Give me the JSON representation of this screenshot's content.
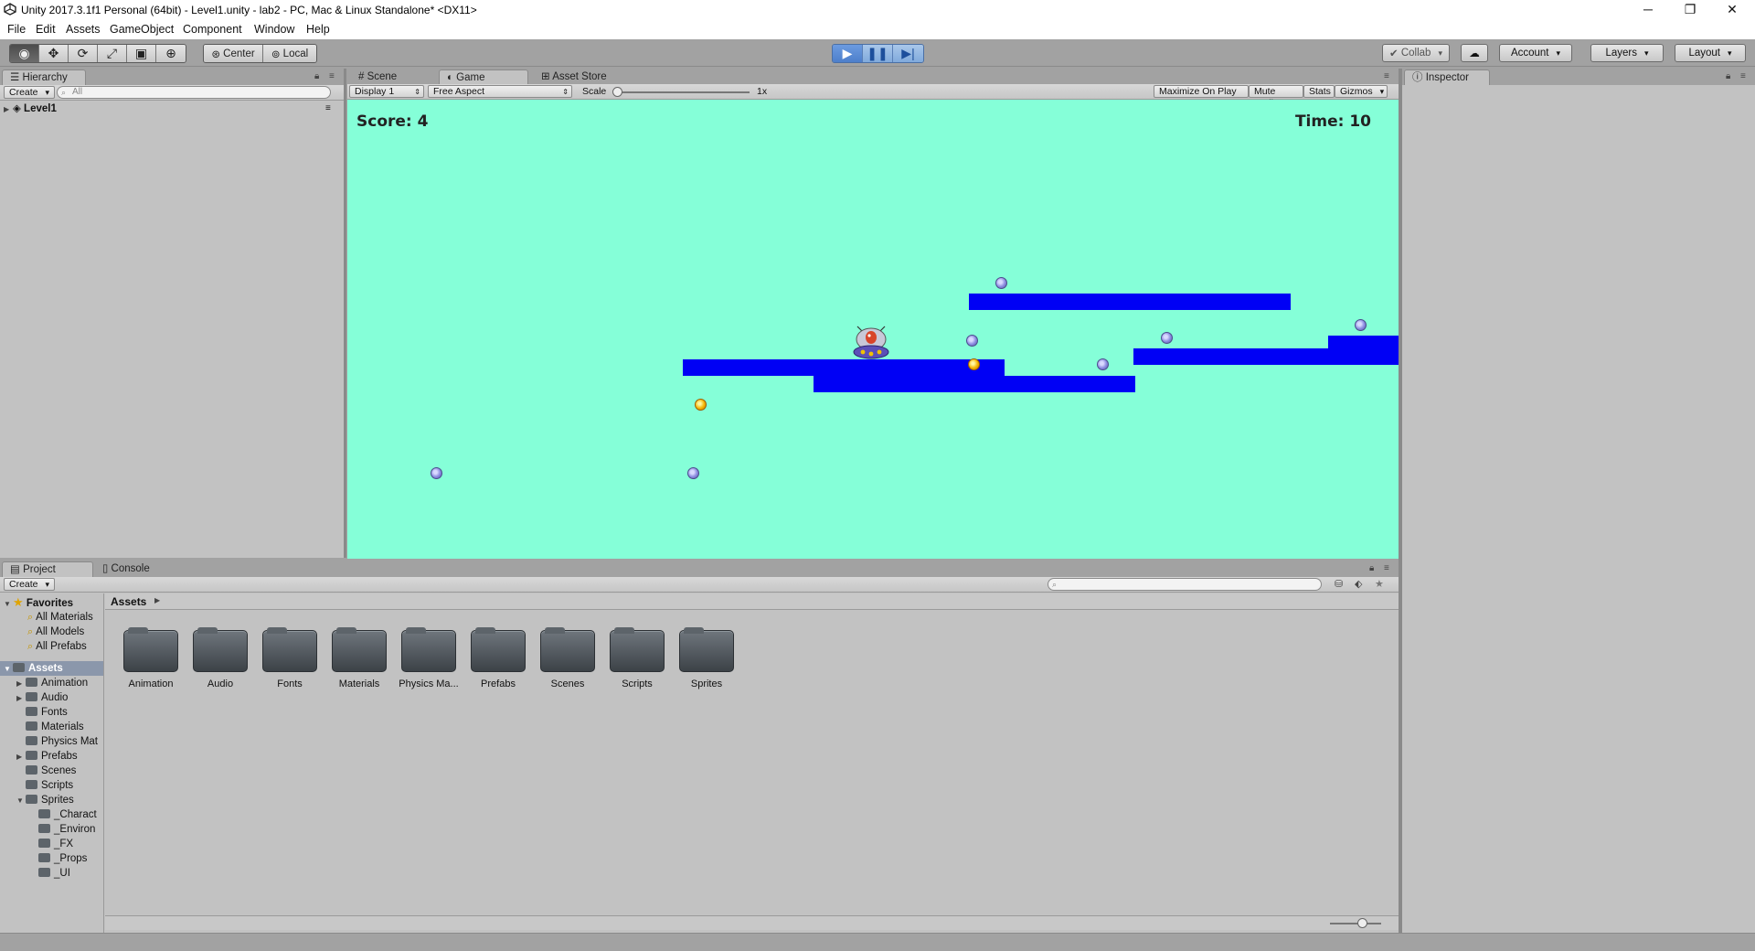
{
  "window": {
    "title": "Unity 2017.3.1f1 Personal (64bit) - Level1.unity - lab2 - PC, Mac & Linux Standalone* <DX11>",
    "controls": [
      "─",
      "❐",
      "✕"
    ]
  },
  "menu": [
    "File",
    "Edit",
    "Assets",
    "GameObject",
    "Component",
    "Window",
    "Help"
  ],
  "toolbar": {
    "pivot": "Center",
    "space": "Local",
    "collab": "Collab",
    "account": "Account",
    "layers": "Layers",
    "layout": "Layout",
    "play_state": "playing"
  },
  "hierarchy": {
    "tab": "Hierarchy",
    "create": "Create",
    "search_placeholder": "All",
    "scene": "Level1"
  },
  "center_tabs": [
    "Scene",
    "Game",
    "Asset Store"
  ],
  "game_bar": {
    "display": "Display 1",
    "aspect": "Free Aspect",
    "scale_label": "Scale",
    "scale_value": "1x",
    "maximize": "Maximize On Play",
    "mute": "Mute Audio",
    "stats": "Stats",
    "gizmos": "Gizmos"
  },
  "game": {
    "score": "Score: 4",
    "time": "Time: 10",
    "colors": {
      "sky": "#85ffd8",
      "platform": "#0000f5"
    }
  },
  "inspector": {
    "tab": "Inspector"
  },
  "project": {
    "tabs": [
      "Project",
      "Console"
    ],
    "create": "Create",
    "breadcrumb": "Assets",
    "favorites_label": "Favorites",
    "favorites": [
      "All Materials",
      "All Models",
      "All Prefabs"
    ],
    "assets_label": "Assets",
    "tree": [
      {
        "label": "Animation",
        "expand": "▶"
      },
      {
        "label": "Audio",
        "expand": "▶"
      },
      {
        "label": "Fonts",
        "expand": ""
      },
      {
        "label": "Materials",
        "expand": ""
      },
      {
        "label": "Physics Mat",
        "expand": ""
      },
      {
        "label": "Prefabs",
        "expand": "▶"
      },
      {
        "label": "Scenes",
        "expand": ""
      },
      {
        "label": "Scripts",
        "expand": ""
      },
      {
        "label": "Sprites",
        "expand": "▼"
      }
    ],
    "sprite_children": [
      "_Charact",
      "_Environ",
      "_FX",
      "_Props",
      "_UI"
    ],
    "folders": [
      "Animation",
      "Audio",
      "Fonts",
      "Materials",
      "Physics Ma...",
      "Prefabs",
      "Scenes",
      "Scripts",
      "Sprites"
    ]
  }
}
